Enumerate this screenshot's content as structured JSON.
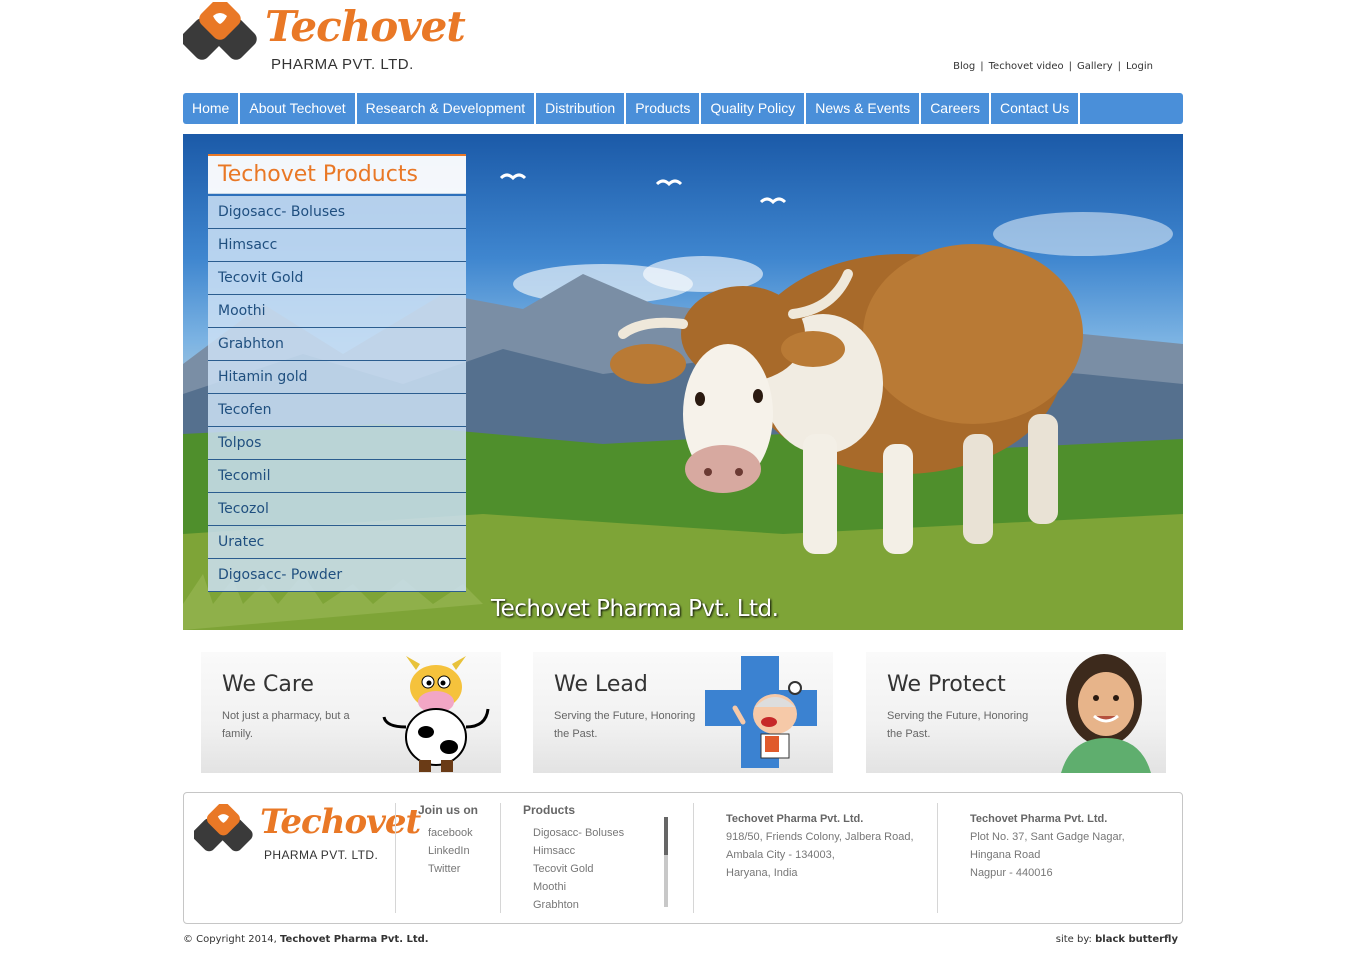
{
  "brand": {
    "name": "Techovet",
    "subtitle": "PHARMA PVT. LTD.",
    "orange": "#e97826",
    "blue": "#4a8fd9"
  },
  "toplinks": [
    "Blog",
    "Techovet video",
    "Gallery",
    "Login"
  ],
  "nav": [
    "Home",
    "About Techovet",
    "Research & Development",
    "Distribution",
    "Products",
    "Quality Policy",
    "News & Events",
    "Careers",
    "Contact Us"
  ],
  "hero": {
    "products_title": "Techovet Products",
    "products": [
      "Digosacc- Boluses",
      "Himsacc",
      "Tecovit Gold",
      "Moothi",
      "Grabhton",
      "Hitamin gold",
      "Tecofen",
      "Tolpos",
      "Tecomil",
      "Tecozol",
      "Uratec",
      "Digosacc- Powder"
    ],
    "caption": "Techovet Pharma Pvt. Ltd."
  },
  "features": [
    {
      "title": "We Care",
      "text": "Not just a pharmacy, but a family."
    },
    {
      "title": "We Lead",
      "text": "Serving the Future, Honoring the Past."
    },
    {
      "title": "We Protect",
      "text": "Serving the Future, Honoring the Past."
    }
  ],
  "footer": {
    "logo_name": "Techovet",
    "logo_sub": "PHARMA PVT. LTD.",
    "join_head": "Join us on",
    "social": [
      "facebook",
      "LinkedIn",
      "Twitter"
    ],
    "products_head": "Products",
    "products": [
      "Digosacc- Boluses",
      "Himsacc",
      "Tecovit Gold",
      "Moothi",
      "Grabhton"
    ],
    "address1": {
      "name": "Techovet Pharma Pvt. Ltd.",
      "lines": [
        "918/50, Friends Colony, Jalbera Road,",
        "Ambala City - 134003,",
        "Haryana, India"
      ]
    },
    "address2": {
      "name": "Techovet Pharma Pvt. Ltd.",
      "lines": [
        "Plot No. 37, Sant Gadge Nagar,",
        "Hingana Road",
        "Nagpur - 440016"
      ]
    }
  },
  "copyright": {
    "prefix": "© Copyright 2014,",
    "company": "Techovet Pharma Pvt. Ltd."
  },
  "credit": {
    "prefix": "site by:",
    "name": "black butterfly"
  }
}
